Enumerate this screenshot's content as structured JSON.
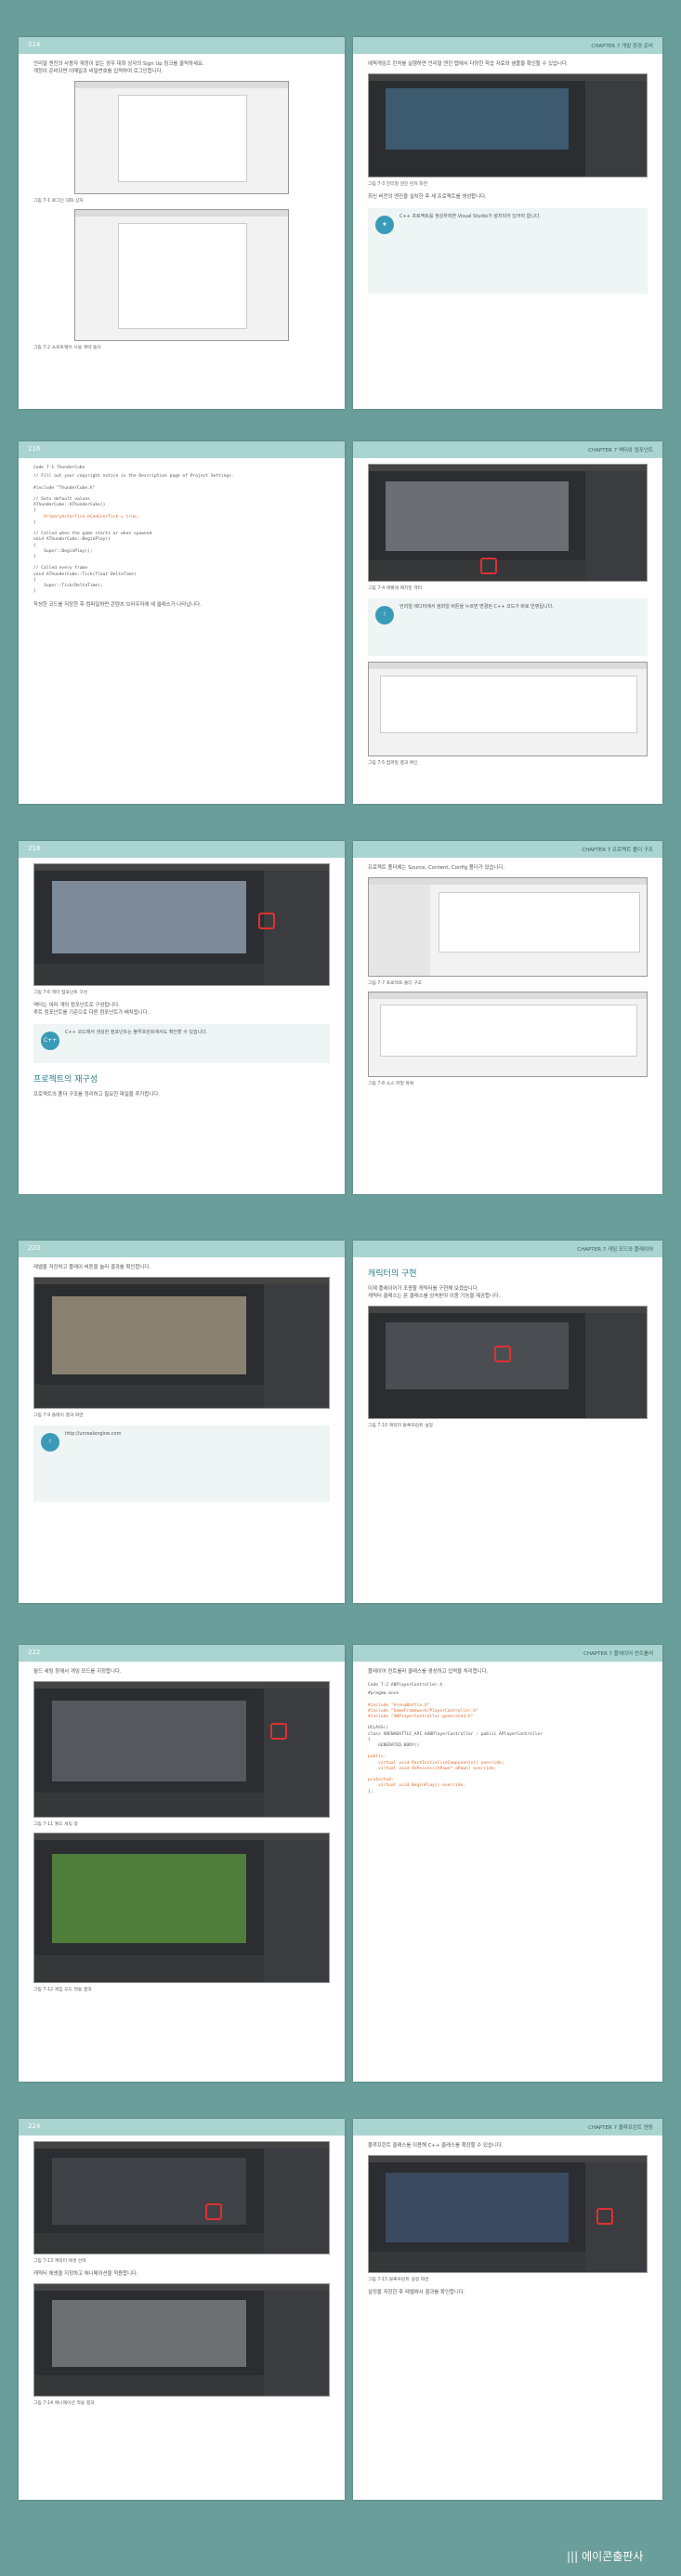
{
  "spreads": [
    {
      "left": {
        "page_number": "214",
        "body": [
          "언리얼 엔진의 사용자 계정이 없는 경우 대화 상자의 Sign Up 링크를 클릭하세요.",
          "계정이 준비되면 이메일과 비밀번호를 입력하여 로그인합니다."
        ],
        "captions": [
          "그림 7-1 로그인 대화 상자",
          "그림 7-2 소프트웨어 사용 계약 동의"
        ]
      },
      "right": {
        "chapter": "CHAPTER 7 개발 환경 준비",
        "page_number": "215",
        "body": [
          "에픽게임즈 런처를 실행하면 언리얼 엔진 탭에서 다양한 학습 자료와 샘플을 확인할 수 있습니다.",
          "최신 버전의 엔진을 설치한 후 새 프로젝트를 생성합니다."
        ],
        "captions": [
          "그림 7-3 언리얼 엔진 런처 화면"
        ],
        "note": "C++ 프로젝트를 생성하려면 Visual Studio가 설치되어 있어야 합니다."
      }
    },
    {
      "left": {
        "page_number": "216",
        "code_title": "Code 7-1 ThunderCube",
        "code": [
          "// Fill out your copyright notice in the Description page of Project Settings.",
          "",
          "#include \"ThunderCube.h\"",
          "",
          "// Sets default values",
          "AThunderCube::AThunderCube()",
          "{",
          "    PrimaryActorTick.bCanEverTick = true;",
          "}",
          "",
          "// Called when the game starts or when spawned",
          "void AThunderCube::BeginPlay()",
          "{",
          "    Super::BeginPlay();",
          "}",
          "",
          "// Called every frame",
          "void AThunderCube::Tick(float DeltaTime)",
          "{",
          "    Super::Tick(DeltaTime);",
          "}"
        ],
        "body": [
          "작성한 코드를 저장한 후 컴파일하면 콘텐츠 브라우저에 새 클래스가 나타납니다."
        ]
      },
      "right": {
        "chapter": "CHAPTER 7 액터와 컴포넌트",
        "page_number": "217",
        "captions": [
          "그림 7-4 레벨에 배치된 액터",
          "그림 7-5 컴파일 결과 확인"
        ],
        "note": "언리얼 에디터에서 컴파일 버튼을 누르면 변경된 C++ 코드가 바로 반영됩니다."
      }
    },
    {
      "left": {
        "page_number": "218",
        "captions": [
          "그림 7-6 액터 컴포넌트 구성"
        ],
        "body": [
          "액터는 여러 개의 컴포넌트로 구성됩니다.",
          "루트 컴포넌트를 기준으로 다른 컴포넌트가 배치됩니다."
        ],
        "note": "C++ 코드에서 생성한 컴포넌트는 블루프린트에서도 확인할 수 있습니다.",
        "heading": "프로젝트의 재구성",
        "body2": [
          "프로젝트의 폴더 구조를 정리하고 필요한 파일을 추가합니다."
        ]
      },
      "right": {
        "chapter": "CHAPTER 7 프로젝트 폴더 구조",
        "page_number": "219",
        "body": [
          "프로젝트 폴더에는 Source, Content, Config 폴더가 있습니다."
        ],
        "captions": [
          "그림 7-7 프로젝트 폴더 구조",
          "그림 7-8 소스 파일 목록"
        ]
      }
    },
    {
      "left": {
        "page_number": "220",
        "body": [
          "레벨을 저장하고 플레이 버튼을 눌러 결과를 확인합니다."
        ],
        "captions": [
          "그림 7-9 플레이 결과 화면"
        ],
        "note": "http://unrealengine.com"
      },
      "right": {
        "chapter": "CHAPTER 7 게임 모드와 플레이어",
        "page_number": "221",
        "heading": "캐릭터의 구현",
        "body": [
          "이제 플레이어가 조종할 캐릭터를 구현해 보겠습니다.",
          "캐릭터 클래스는 폰 클래스를 상속받아 이동 기능을 제공합니다."
        ],
        "captions": [
          "그림 7-10 캐릭터 블루프린트 설정"
        ]
      }
    },
    {
      "left": {
        "page_number": "222",
        "body": [
          "월드 세팅 창에서 게임 모드를 지정합니다."
        ],
        "captions": [
          "그림 7-11 월드 세팅 창",
          "그림 7-12 게임 모드 적용 결과"
        ]
      },
      "right": {
        "chapter": "CHAPTER 7 플레이어 컨트롤러",
        "page_number": "223",
        "body": [
          "플레이어 컨트롤러 클래스를 생성하고 입력을 처리합니다."
        ],
        "code_title": "Code 7-2 ABPlayerController.h",
        "code": [
          "#pragma once",
          "",
          "#include \"ArenaBattle.h\"",
          "#include \"GameFramework/PlayerController.h\"",
          "#include \"ABPlayerController.generated.h\"",
          "",
          "UCLASS()",
          "class ARENABATTLE_API AABPlayerController : public APlayerController",
          "{",
          "    GENERATED_BODY()",
          "",
          "public:",
          "    virtual void PostInitializeComponents() override;",
          "    virtual void OnPossess(APawn* aPawn) override;",
          "",
          "protected:",
          "    virtual void BeginPlay() override;",
          "};"
        ]
      }
    },
    {
      "left": {
        "page_number": "224",
        "captions": [
          "그림 7-13 캐릭터 에셋 선택",
          "그림 7-14 애니메이션 적용 결과"
        ],
        "body": [
          "캐릭터 에셋을 지정하고 애니메이션을 적용합니다."
        ]
      },
      "right": {
        "chapter": "CHAPTER 7 블루프린트 연동",
        "page_number": "225",
        "body": [
          "블루프린트 클래스를 이용해 C++ 클래스를 확장할 수 있습니다."
        ],
        "captions": [
          "그림 7-15 블루프린트 설정 화면"
        ],
        "body2": [
          "설정을 저장한 후 레벨에서 결과를 확인합니다."
        ]
      }
    }
  ],
  "footer": {
    "brand_mark": "|||",
    "brand": "에이콘출판사"
  },
  "colors": {
    "background": "#6a9e9a",
    "header": "#a9d4cf",
    "accent": "#2a7f8c",
    "highlight": "#e06a2a"
  }
}
